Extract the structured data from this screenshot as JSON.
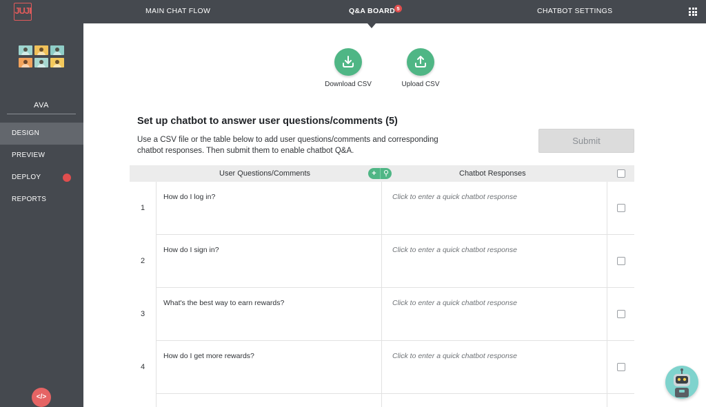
{
  "app": {
    "logo_text": "JUJI"
  },
  "nav": {
    "tabs": [
      {
        "label": "MAIN CHAT FLOW"
      },
      {
        "label": "Q&A BOARD",
        "badge": "5"
      },
      {
        "label": "CHATBOT SETTINGS"
      }
    ],
    "active_tab": "Q&A BOARD",
    "apps_icon": "grid-icon"
  },
  "sidebar": {
    "agent_name": "AVA",
    "items": [
      {
        "label": "DESIGN"
      },
      {
        "label": "PREVIEW"
      },
      {
        "label": "DEPLOY"
      },
      {
        "label": "REPORTS"
      }
    ],
    "active_item": "DESIGN",
    "code_button_label": "</>",
    "avatar_colors": [
      "#9ed5cf",
      "#f0c15a",
      "#8fcdc7",
      "#f2a35c",
      "#a6d7d0",
      "#f4c95c"
    ]
  },
  "csv": {
    "download_label": "Download CSV",
    "upload_label": "Upload CSV"
  },
  "main": {
    "title": "Set up chatbot to answer user questions/comments (5)",
    "description": "Use a CSV file or the table below to add user questions/comments and corresponding chatbot responses. Then submit them to enable chatbot Q&A.",
    "submit_label": "Submit"
  },
  "table": {
    "col_questions": "User Questions/Comments",
    "col_responses": "Chatbot Responses",
    "add_button": "+",
    "search_button": "⚲",
    "response_placeholder": "Click to enter a quick chatbot response",
    "rows": [
      {
        "num": "1",
        "question": "How do I log in?"
      },
      {
        "num": "2",
        "question": "How do I sign in?"
      },
      {
        "num": "3",
        "question": "What's the best way to earn rewards?"
      },
      {
        "num": "4",
        "question": "How do I get more rewards?"
      }
    ]
  },
  "colors": {
    "topbar": "#45494f",
    "accent_green": "#4fb685",
    "badge_red": "#e04e4e",
    "submit_disabled": "#dcdcdc"
  }
}
